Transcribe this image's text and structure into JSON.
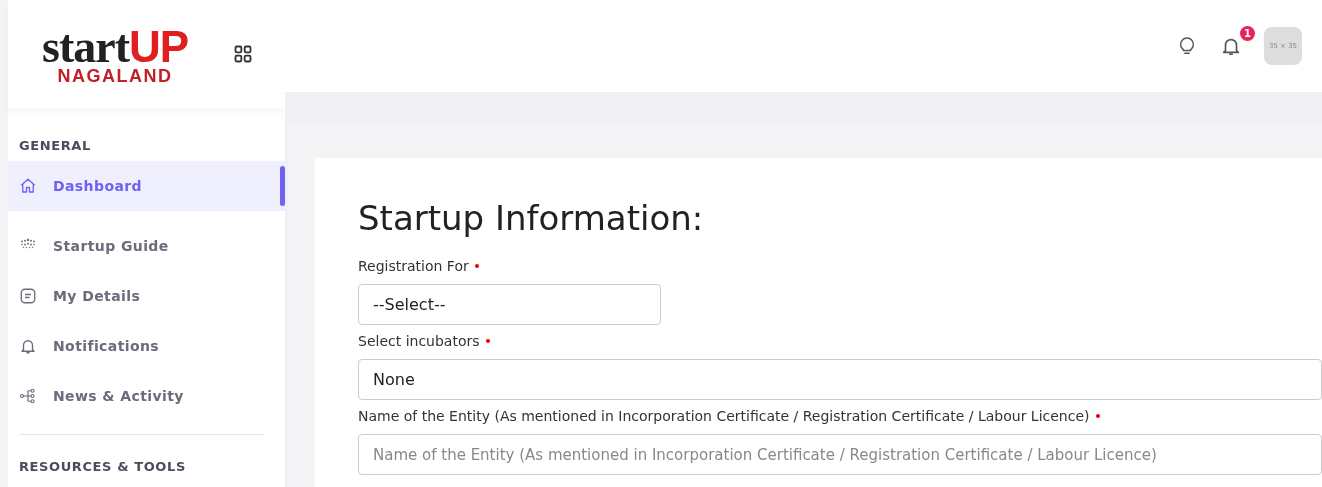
{
  "logo": {
    "word_left": "start",
    "word_right": "UP",
    "subtitle": "NAGALAND"
  },
  "sidebar": {
    "sections": [
      {
        "title": "GENERAL",
        "items": [
          {
            "label": "Dashboard",
            "selected": true
          },
          {
            "label": "Startup Guide",
            "selected": false
          },
          {
            "label": "My Details",
            "selected": false
          },
          {
            "label": "Notifications",
            "selected": false
          },
          {
            "label": "News & Activity",
            "selected": false
          }
        ]
      },
      {
        "title": "RESOURCES & TOOLS"
      }
    ]
  },
  "header": {
    "notification_count": "1",
    "avatar": "35 × 35"
  },
  "form": {
    "title": "Startup Information:",
    "fields": [
      {
        "label": "Registration For",
        "required": true,
        "kind": "select",
        "value": "--Select--"
      },
      {
        "label": "Select incubators",
        "required": true,
        "kind": "select-wide",
        "value": "None"
      },
      {
        "label": "Name of the Entity (As mentioned in Incorporation Certificate / Registration Certificate / Labour Licence)",
        "required": true,
        "kind": "text",
        "placeholder": "Name of the Entity (As mentioned in Incorporation Certificate / Registration Certificate / Labour Licence)"
      }
    ]
  }
}
